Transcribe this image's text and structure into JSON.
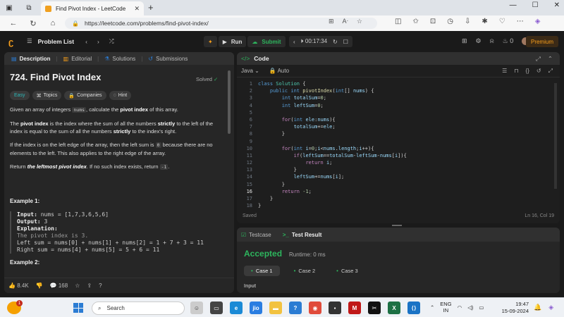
{
  "browser": {
    "tab_title": "Find Pivot Index - LeetCode",
    "url": "https://leetcode.com/problems/find-pivot-index/"
  },
  "nav": {
    "problem_list": "Problem List",
    "run": "Run",
    "submit": "Submit",
    "timer": "00:17:34",
    "streak": "0",
    "premium": "Premium"
  },
  "left_tabs": [
    "Description",
    "Editorial",
    "Solutions",
    "Submissions"
  ],
  "problem": {
    "title": "724. Find Pivot Index",
    "status": "Solved",
    "tags": [
      "Easy",
      "Topics",
      "Companies",
      "Hint"
    ],
    "p1_pre": "Given an array of integers ",
    "p1_code": "nums",
    "p1_mid": ", calculate the ",
    "p1_bold": "pivot index",
    "p1_post": " of this array.",
    "p2_b1": "pivot index",
    "p2_a": "The ",
    "p2_b": " is the index where the sum of all the numbers ",
    "p2_b2": "strictly",
    "p2_c": " to the left of the index is equal to the sum of all the numbers ",
    "p2_b3": "strictly",
    "p2_d": " to the index's right.",
    "p3_a": "If the index is on the left edge of the array, then the left sum is ",
    "p3_code": "0",
    "p3_b": " because there are no elements to the left. This also applies to the right edge of the array.",
    "p4_a": "Return ",
    "p4_b": "the leftmost pivot index",
    "p4_c": ". If no such index exists, return ",
    "p4_code": "-1",
    "p4_d": ".",
    "example1_title": "Example 1:",
    "ex_input_label": "Input:",
    "ex_input": "nums = [1,7,3,6,5,6]",
    "ex_output_label": "Output:",
    "ex_output": "3",
    "ex_expl_label": "Explanation:",
    "ex_lines": [
      "The pivot index is 3.",
      "Left sum = nums[0] + nums[1] + nums[2] = 1 + 7 + 3 = 11",
      "Right sum = nums[4] + nums[5] = 5 + 6 = 11"
    ],
    "example2_title": "Example 2:",
    "likes": "8.4K",
    "comments": "168"
  },
  "editor": {
    "header": "Code",
    "language": "Java",
    "mode": "Auto",
    "saved": "Saved",
    "position": "Ln 16, Col 19",
    "line_numbers": [
      "1",
      "2",
      "3",
      "4",
      "5",
      "6",
      "7",
      "8",
      "9",
      "10",
      "11",
      "12",
      "13",
      "14",
      "15",
      "16",
      "17",
      "18"
    ],
    "lines": [
      "class Solution {",
      "    public int pivotIndex(int[] nums) {",
      "        int totalSum=0;",
      "        int leftSum=0;",
      "",
      "        for(int ele:nums){",
      "            totalSum+=ele;",
      "        }",
      "",
      "        for(int i=0;i<nums.length;i++){",
      "            if(leftSum==totalSum-leftSum-nums[i]){",
      "                return i;",
      "            }",
      "            leftSum+=nums[i];",
      "        }",
      "        return -1;",
      "    }",
      "}"
    ]
  },
  "result": {
    "tabs": [
      "Testcase",
      "Test Result"
    ],
    "verdict": "Accepted",
    "runtime": "Runtime: 0 ms",
    "cases": [
      "Case 1",
      "Case 2",
      "Case 3"
    ],
    "input_label": "Input"
  },
  "taskbar": {
    "search": "Search",
    "news_badge": "1",
    "lang1": "ENG",
    "lang2": "IN",
    "time": "19:47",
    "date": "15-09-2024"
  },
  "colors": {
    "accent_orange": "#f89f1b",
    "accepted_green": "#2db55d",
    "easy_teal": "#2db8b8"
  }
}
